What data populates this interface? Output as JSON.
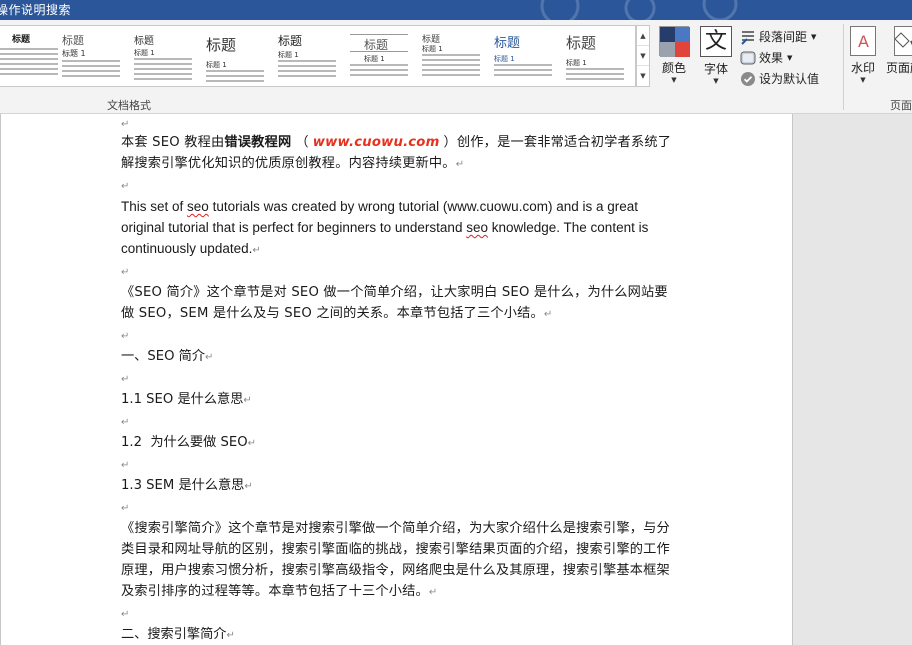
{
  "window": {
    "title": "操作说明搜索"
  },
  "ribbon": {
    "style_gallery": [
      {
        "heading": "标题",
        "subheading": ""
      },
      {
        "heading": "标题",
        "subheading": "标题 1"
      },
      {
        "heading": "标题",
        "subheading": "标题 1"
      },
      {
        "heading": "标题",
        "subheading": "标题 1"
      },
      {
        "heading": "标题",
        "subheading": "标题 1"
      },
      {
        "heading": "标题",
        "subheading": "标题 1"
      },
      {
        "heading": "标题",
        "subheading": "标题 1"
      },
      {
        "heading": "标题",
        "subheading": "标题 1"
      },
      {
        "heading": "标题",
        "subheading": "标题 1"
      }
    ],
    "colors_label": "颜色",
    "fonts_label": "字体",
    "fonts_glyph": "文",
    "paragraph_spacing_label": "段落间距",
    "effects_label": "效果",
    "set_default_label": "设为默认值",
    "watermark_label": "水印",
    "page_color_label": "页面颜",
    "group_document_format": "文档格式",
    "group_page_background": "页面"
  },
  "document": {
    "p1_a": "本套 SEO 教程由",
    "p1_bold": "错误教程网",
    "p1_b": "（",
    "p1_site": "www.cuowu.com",
    "p1_c": "）创作，是一套非常适合初学者系统了解搜索引擎优化知识的优质原创教程。内容持续更新中。",
    "p2_a": "This set of ",
    "p2_seo1": "seo",
    "p2_b": " tutorials was created by wrong tutorial (www.cuowu.com) and is a great original tutorial that is perfect for beginners to understand ",
    "p2_seo2": "seo",
    "p2_c": " knowledge. The content is continuously updated.",
    "p3": "《SEO 简介》这个章节是对 SEO 做一个简单介绍，让大家明白 SEO 是什么，为什么网站要做 SEO，SEM 是什么及与 SEO 之间的关系。本章节包括了三个小结。",
    "h1": "一、SEO 简介",
    "s11": "1.1 SEO 是什么意思",
    "s12": "1.2  为什么要做 SEO",
    "s13": "1.3 SEM 是什么意思",
    "p4": "《搜索引擎简介》这个章节是对搜索引擎做一个简单介绍，为大家介绍什么是搜索引擎，与分类目录和网址导航的区别，搜索引擎面临的挑战，搜索引擎结果页面的介绍，搜索引擎的工作原理，用户搜索习惯分析，搜索引擎高级指令，网络爬虫是什么及其原理，搜索引擎基本框架及索引排序的过程等等。本章节包括了十三个小结。",
    "h2": "二、搜索引擎简介",
    "para_mark": "↵"
  },
  "colors": {
    "ribbon_blue": "#2b579a",
    "swatch_navy": "#263d6b",
    "swatch_blue": "#4a78c2",
    "swatch_gray": "#9aa3ad",
    "swatch_red": "#e0443a",
    "site_red": "#e8301c"
  }
}
